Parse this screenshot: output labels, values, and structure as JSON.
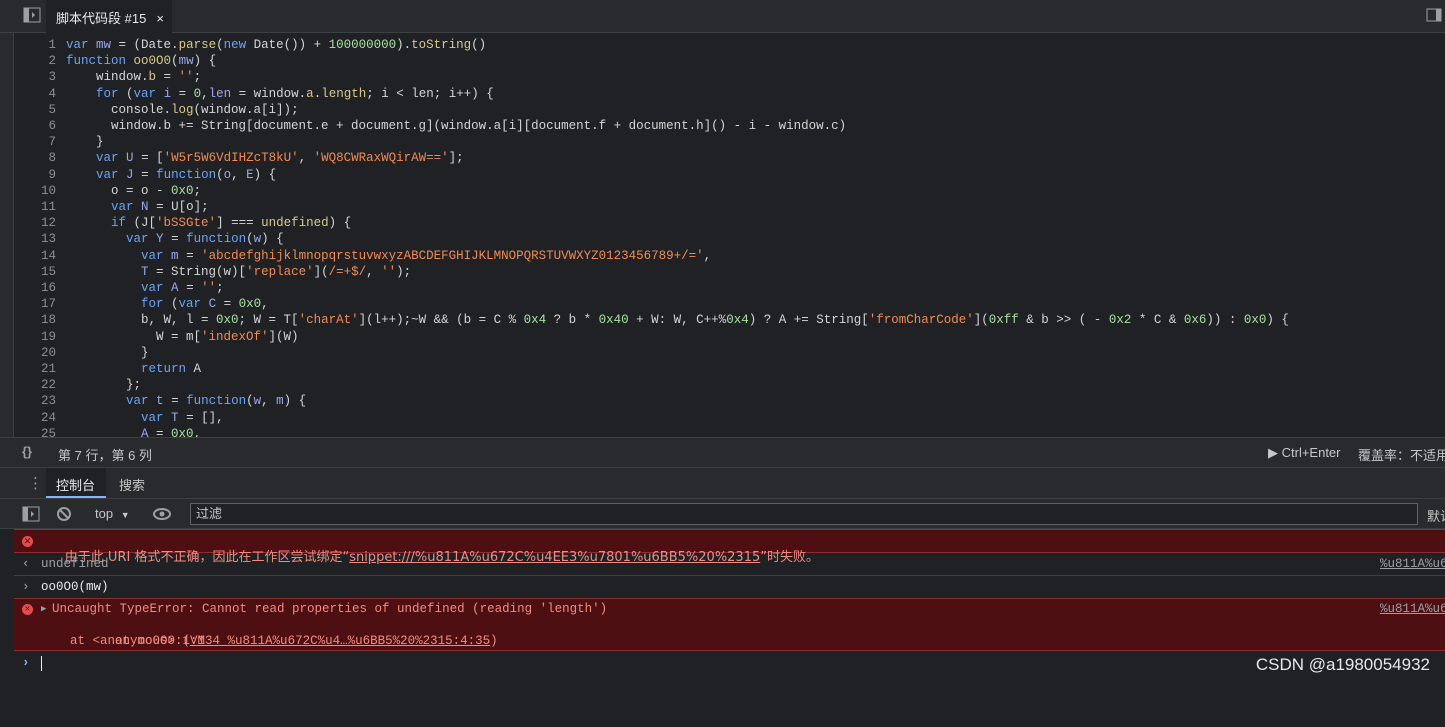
{
  "topbar": {
    "tab_title": "脚本代码段 #15",
    "close": "×",
    "sidebar_toggle_icon": "panel-toggle-icon",
    "right_icon": "panel-right-icon"
  },
  "editor": {
    "lines": [
      {
        "n": "1",
        "html": "<span class=\"k\">var</span> <span class=\"p\">mw</span> = (Date.<span class=\"f\">parse</span>(<span class=\"k\">new</span> Date()) + <span class=\"n\">100000000</span>).<span class=\"f\">toString</span>()"
      },
      {
        "n": "2",
        "html": "<span class=\"k\">function</span> <span class=\"f\">oo0O0</span>(<span class=\"p\">mw</span>) {"
      },
      {
        "n": "3",
        "html": "    window.<span class=\"f\">b</span> = <span class=\"s\">''</span>;"
      },
      {
        "n": "4",
        "html": "    <span class=\"k\">for</span> (<span class=\"k\">var</span> <span class=\"p\">i</span> = <span class=\"n\">0</span>,<span class=\"p\">len</span> = window.<span class=\"f\">a</span>.<span class=\"f\">length</span>; i &lt; len; i++) {"
      },
      {
        "n": "5",
        "html": "      console.<span class=\"f\">log</span>(window.a[i]);"
      },
      {
        "n": "6",
        "html": "      window.b += String[document.e + document.g](window.a[i][document.f + document.h]() - i - window.c)"
      },
      {
        "n": "7",
        "html": "    }"
      },
      {
        "n": "8",
        "html": "    <span class=\"k\">var</span> <span class=\"p\">U</span> = [<span class=\"s\">'W5r5W6VdIHZcT8kU'</span>, <span class=\"s\">'WQ8CWRaxWQirAW=='</span>];"
      },
      {
        "n": "9",
        "html": "    <span class=\"k\">var</span> <span class=\"p\">J</span> = <span class=\"k\">function</span>(<span class=\"p\">o</span>, <span class=\"p\">E</span>) {"
      },
      {
        "n": "10",
        "html": "      o = o - <span class=\"n\">0x0</span>;"
      },
      {
        "n": "11",
        "html": "      <span class=\"k\">var</span> <span class=\"p\">N</span> = U[o];"
      },
      {
        "n": "12",
        "html": "      <span class=\"k\">if</span> (J[<span class=\"s\">'bSSGte'</span>] === <span class=\"f\">undefined</span>) {"
      },
      {
        "n": "13",
        "html": "        <span class=\"k\">var</span> <span class=\"p\">Y</span> = <span class=\"k\">function</span>(<span class=\"p\">w</span>) {"
      },
      {
        "n": "14",
        "html": "          <span class=\"k\">var</span> <span class=\"p\">m</span> = <span class=\"s\">'abcdefghijklmnopqrstuvwxyzABCDEFGHIJKLMNOPQRSTUVWXYZ0123456789+/='</span>,"
      },
      {
        "n": "15",
        "html": "          <span class=\"p\">T</span> = String(w)[<span class=\"s\">'replace'</span>](<span class=\"s\">/=+$/</span>, <span class=\"s\">''</span>);"
      },
      {
        "n": "16",
        "html": "          <span class=\"k\">var</span> <span class=\"p\">A</span> = <span class=\"s\">''</span>;"
      },
      {
        "n": "17",
        "html": "          <span class=\"k\">for</span> (<span class=\"k\">var</span> <span class=\"p\">C</span> = <span class=\"n\">0x0</span>,"
      },
      {
        "n": "18",
        "html": "          b, W, l = <span class=\"n\">0x0</span>; W = T[<span class=\"s\">'charAt'</span>](l++);~W &amp;&amp; (b = C % <span class=\"n\">0x4</span> ? b * <span class=\"n\">0x40</span> + W: W, C++%<span class=\"n\">0x4</span>) ? A += String[<span class=\"s\">'fromCharCode'</span>](<span class=\"n\">0xff</span> &amp; b &gt;&gt; ( - <span class=\"n\">0x2</span> * C &amp; <span class=\"n\">0x6</span>)) : <span class=\"n\">0x0</span>) {"
      },
      {
        "n": "19",
        "html": "            W = m[<span class=\"s\">'indexOf'</span>](W)"
      },
      {
        "n": "20",
        "html": "          }"
      },
      {
        "n": "21",
        "html": "          <span class=\"k\">return</span> A"
      },
      {
        "n": "22",
        "html": "        };"
      },
      {
        "n": "23",
        "html": "        <span class=\"k\">var</span> <span class=\"p\">t</span> = <span class=\"k\">function</span>(<span class=\"p\">w</span>, <span class=\"p\">m</span>) {"
      },
      {
        "n": "24",
        "html": "          <span class=\"k\">var</span> <span class=\"p\">T</span> = [],"
      },
      {
        "n": "25",
        "html": "          <span class=\"p\">A</span> = <span class=\"n\">0x0</span>,"
      }
    ]
  },
  "status": {
    "braces": "{}",
    "position": "第 7 行，第 6 列",
    "run": "▶ Ctrl+Enter",
    "coverage": "覆盖率：不适用"
  },
  "drawer": {
    "menu": "⋮",
    "tab_console": "控制台",
    "tab_search": "搜索"
  },
  "console_toolbar": {
    "context": "top",
    "filter_placeholder": "过滤",
    "right_label": "默认"
  },
  "messages": {
    "err1_text": "由于此 URI 格式不正确，因此在工作区尝试绑定“",
    "err1_link": "snippet:///%u811A%u672C%u4EE3%u7801%u6BB5%20%2315",
    "err1_tail": "”时失败。",
    "undef_text": "undefined",
    "undef_src": "%u811A%u6",
    "input_text": "oo0O0(mw)",
    "err2_head": "Uncaught TypeError: Cannot read properties of undefined (reading 'length')",
    "err2_src": "%u811A%u6",
    "err2_at1": "    at oo0O0 (",
    "err2_at1_link": "VM34 %u811A%u672C%u4…%u6BB5%20%2315:4:35",
    "err2_at1_tail": ")",
    "err2_at2": "    at <anonymous>:1:1",
    "prompt": "›"
  },
  "watermark": "CSDN @a1980054932"
}
